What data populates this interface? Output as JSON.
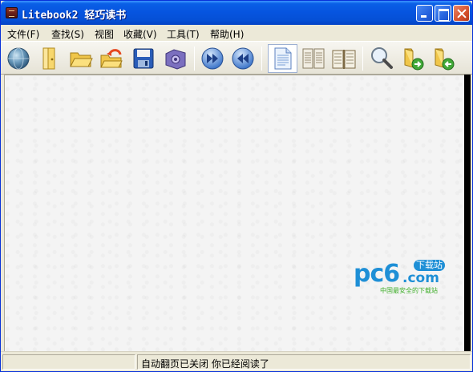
{
  "window": {
    "title": "Litebook2 轻巧读书"
  },
  "menu": {
    "items": [
      {
        "label": "文件(F)"
      },
      {
        "label": "查找(S)"
      },
      {
        "label": "视图"
      },
      {
        "label": "收藏(V)"
      },
      {
        "label": "工具(T)"
      },
      {
        "label": "帮助(H)"
      }
    ]
  },
  "toolbar": {
    "icons": [
      "globe-icon",
      "bookmark-door-icon",
      "open-folder-icon",
      "undo-folder-icon",
      "save-icon",
      "settings-box-icon",
      "forward-icon",
      "back-icon",
      "single-page-icon",
      "two-page-icon",
      "book-spread-icon",
      "search-icon",
      "folder-next-icon",
      "folder-prev-icon"
    ]
  },
  "watermark": {
    "brand": "pc6",
    "domain": ".com",
    "tag": "下载站",
    "slogan": "中国最安全的下载站"
  },
  "status": {
    "text": "自动翻页已关闭 你已经阅读了"
  },
  "colors": {
    "titlebar": "#0654df",
    "window_bg": "#ece9d8",
    "close_button": "#d6512c",
    "watermark_blue": "#1e8fd6",
    "watermark_green": "#3fae2a"
  }
}
